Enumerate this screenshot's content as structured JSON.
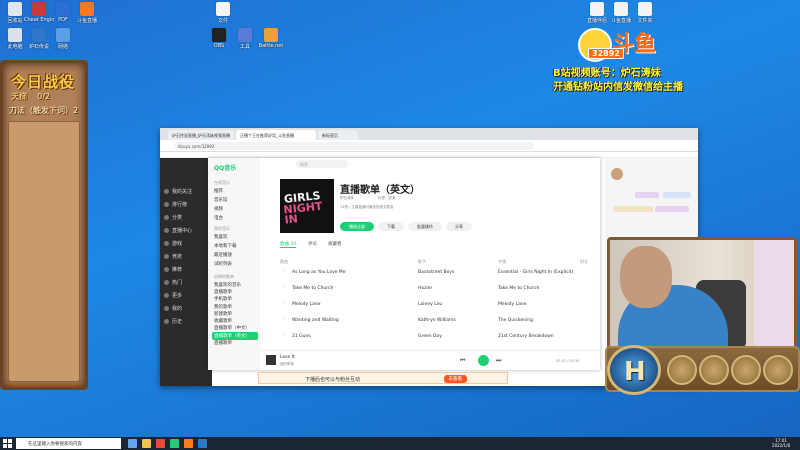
{
  "desktop": {
    "icons_left": [
      {
        "label": "回收站",
        "color": "#dfe6f0"
      },
      {
        "label": "Cheat Engine",
        "color": "#c93a3a"
      },
      {
        "label": "PDF",
        "color": "#2c6fd8"
      },
      {
        "label": "斗鱼直播",
        "color": "#ff7a1a"
      },
      {
        "label": "此电脑",
        "color": "#d9e2ec"
      },
      {
        "label": "炉石传说",
        "color": "#2f77c9"
      },
      {
        "label": "网络",
        "color": "#5aa0e6"
      }
    ],
    "icons_mid": [
      {
        "label": "文件",
        "color": "#f4f4f4"
      },
      {
        "label": "OBS",
        "color": "#222222"
      },
      {
        "label": "工具",
        "color": "#5b7bd8"
      },
      {
        "label": "Battle.net",
        "color": "#e8a23a"
      }
    ],
    "icons_right": [
      {
        "label": "直播伴侣",
        "color": "#f2f2f2"
      },
      {
        "label": "斗鱼直播",
        "color": "#f2f2f2"
      },
      {
        "label": "文件夹",
        "color": "#f2f2f2"
      }
    ]
  },
  "quest_card": {
    "title": "今日战役",
    "subtitle_left": "天梯",
    "subtitle_right": "0/2",
    "quest": "刀法（触发下词）2"
  },
  "douyu": {
    "brand": "斗鱼",
    "room_number": "32892",
    "promo_line1": "B站视频账号：炉石涛妹",
    "promo_line2": "开通钻粉站内信发微信给主播"
  },
  "browser": {
    "tabs": [
      "炉石传说直播_炉石涛妹视频直播",
      "正播个王在推荐好用_斗鱼直播",
      "新标签页"
    ],
    "url": "douyu.com/32892"
  },
  "douyu_side_nav": [
    "我的关注",
    "排行榜",
    "分类",
    "直播中心",
    "游戏",
    "竞技",
    "推荐",
    "热门",
    "更多",
    "我的",
    "历史"
  ],
  "qq_music": {
    "logo": "QQ音乐",
    "search_placeholder": "搜索",
    "sections": {
      "main": "在线音乐",
      "mine": "我的音乐",
      "playlists": "创建的歌单"
    },
    "nav_items": [
      "推荐",
      "音乐馆",
      "视频",
      "电台"
    ],
    "mine_items": [
      "我喜欢",
      "本地和下载",
      "最近播放",
      "试听列表"
    ],
    "playlist_items": [
      "我喜欢的音乐",
      "直播歌单",
      "手机歌单",
      "我的歌单",
      "新建歌单",
      "收藏歌单",
      "直播歌单（中文）",
      "直播歌单（英文）",
      "直播歌单"
    ],
    "active_playlist": "直播歌单（英文）",
    "playlist_title": "直播歌单（英文）",
    "cover_line1": "GIRLS",
    "cover_line2": "NIGHT IN",
    "meta_owner": "炉石涛妹",
    "meta_tags": "标签：欧美",
    "meta_desc": "34首 / 主播直播时播放的英文歌曲",
    "buttons": {
      "play_all": "播放全部",
      "download": "下载",
      "batch": "批量操作",
      "share": "分享"
    },
    "tabs": [
      "歌曲 34",
      "评论",
      "收藏者"
    ],
    "active_tab": "歌曲 34",
    "columns": [
      "歌曲",
      "歌手",
      "专辑",
      "时长"
    ],
    "songs": [
      {
        "title": "As Long as You Love Me",
        "artist": "Backstreet Boys",
        "album": "Essential - Girls Night In (Explicit)"
      },
      {
        "title": "Take Me to Church",
        "artist": "Hozier",
        "album": "Take Me to Church"
      },
      {
        "title": "Melody Lane",
        "artist": "Lainey Lou",
        "album": "Melody Lane"
      },
      {
        "title": "Wanting and Waiting",
        "artist": "Kathryn Williams",
        "album": "The Quickening"
      },
      {
        "title": "21 Guns",
        "artist": "Green Day",
        "album": "21st Century Breakdown"
      }
    ],
    "player": {
      "now_playing": "Lose It",
      "artist": "我的歌单",
      "time": "02:02 / 03:34"
    }
  },
  "banner": {
    "text": "下播后也可以与粉丝互动",
    "cta": "去看看"
  },
  "taskbar": {
    "search_placeholder": "在这里输入你要搜索的内容",
    "time": "17:01",
    "date": "2022/1/8"
  },
  "colors": {
    "qq_green": "#1ecf75",
    "douyu_orange": "#ff6a13",
    "promo_yellow": "#fff83c"
  }
}
